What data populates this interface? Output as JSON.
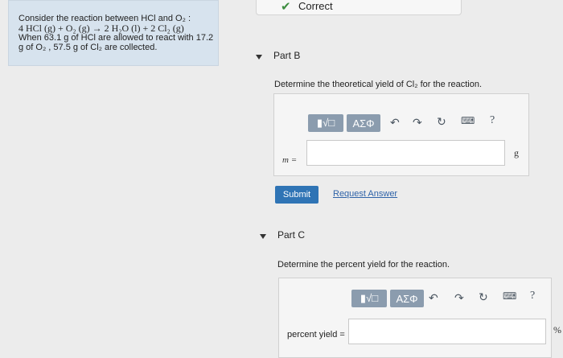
{
  "problem": {
    "line1": "Consider the reaction between HCl and O₂ :",
    "equation": "4 HCl (g) + O₂ (g) → 2 H₂O (l) + 2 Cl₂ (g)",
    "line3": "When 63.1 g of HCl are allowed to react with 17.2",
    "line4": "g of O₂ , 57.5 g of Cl₂ are collected."
  },
  "previous_part": {
    "status": "Correct"
  },
  "part_b": {
    "title": "Part B",
    "prompt": "Determine the theoretical yield of Cl₂ for the reaction.",
    "var_label": "m =",
    "unit": "g",
    "input_value": "",
    "submit_label": "Submit",
    "request_answer_label": "Request Answer"
  },
  "part_c": {
    "title": "Part C",
    "prompt": "Determine the percent yield for the reaction.",
    "var_label": "percent yield =",
    "unit": "%",
    "input_value": ""
  },
  "toolbar": {
    "templates_label": "▮√□",
    "greek_label": "AΣΦ",
    "help_label": "?"
  }
}
